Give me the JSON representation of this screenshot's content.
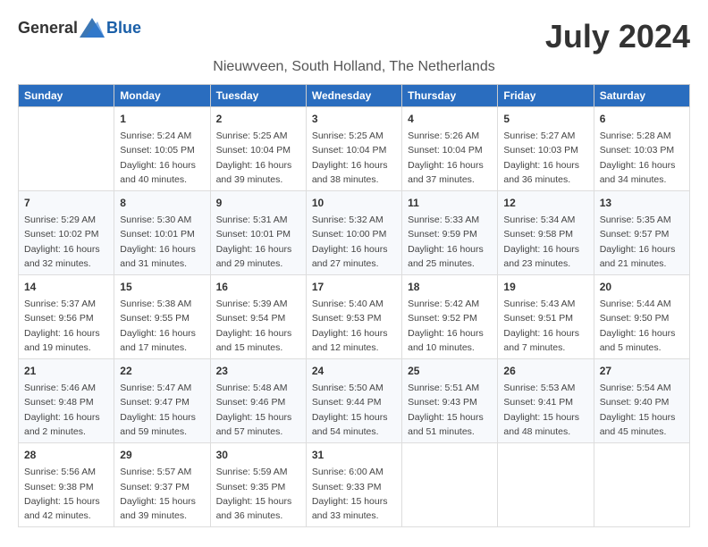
{
  "header": {
    "logo_general": "General",
    "logo_blue": "Blue",
    "month_year": "July 2024",
    "location": "Nieuwveen, South Holland, The Netherlands"
  },
  "columns": [
    "Sunday",
    "Monday",
    "Tuesday",
    "Wednesday",
    "Thursday",
    "Friday",
    "Saturday"
  ],
  "weeks": [
    [
      {
        "day": "",
        "info": ""
      },
      {
        "day": "1",
        "info": "Sunrise: 5:24 AM\nSunset: 10:05 PM\nDaylight: 16 hours\nand 40 minutes."
      },
      {
        "day": "2",
        "info": "Sunrise: 5:25 AM\nSunset: 10:04 PM\nDaylight: 16 hours\nand 39 minutes."
      },
      {
        "day": "3",
        "info": "Sunrise: 5:25 AM\nSunset: 10:04 PM\nDaylight: 16 hours\nand 38 minutes."
      },
      {
        "day": "4",
        "info": "Sunrise: 5:26 AM\nSunset: 10:04 PM\nDaylight: 16 hours\nand 37 minutes."
      },
      {
        "day": "5",
        "info": "Sunrise: 5:27 AM\nSunset: 10:03 PM\nDaylight: 16 hours\nand 36 minutes."
      },
      {
        "day": "6",
        "info": "Sunrise: 5:28 AM\nSunset: 10:03 PM\nDaylight: 16 hours\nand 34 minutes."
      }
    ],
    [
      {
        "day": "7",
        "info": "Sunrise: 5:29 AM\nSunset: 10:02 PM\nDaylight: 16 hours\nand 32 minutes."
      },
      {
        "day": "8",
        "info": "Sunrise: 5:30 AM\nSunset: 10:01 PM\nDaylight: 16 hours\nand 31 minutes."
      },
      {
        "day": "9",
        "info": "Sunrise: 5:31 AM\nSunset: 10:01 PM\nDaylight: 16 hours\nand 29 minutes."
      },
      {
        "day": "10",
        "info": "Sunrise: 5:32 AM\nSunset: 10:00 PM\nDaylight: 16 hours\nand 27 minutes."
      },
      {
        "day": "11",
        "info": "Sunrise: 5:33 AM\nSunset: 9:59 PM\nDaylight: 16 hours\nand 25 minutes."
      },
      {
        "day": "12",
        "info": "Sunrise: 5:34 AM\nSunset: 9:58 PM\nDaylight: 16 hours\nand 23 minutes."
      },
      {
        "day": "13",
        "info": "Sunrise: 5:35 AM\nSunset: 9:57 PM\nDaylight: 16 hours\nand 21 minutes."
      }
    ],
    [
      {
        "day": "14",
        "info": "Sunrise: 5:37 AM\nSunset: 9:56 PM\nDaylight: 16 hours\nand 19 minutes."
      },
      {
        "day": "15",
        "info": "Sunrise: 5:38 AM\nSunset: 9:55 PM\nDaylight: 16 hours\nand 17 minutes."
      },
      {
        "day": "16",
        "info": "Sunrise: 5:39 AM\nSunset: 9:54 PM\nDaylight: 16 hours\nand 15 minutes."
      },
      {
        "day": "17",
        "info": "Sunrise: 5:40 AM\nSunset: 9:53 PM\nDaylight: 16 hours\nand 12 minutes."
      },
      {
        "day": "18",
        "info": "Sunrise: 5:42 AM\nSunset: 9:52 PM\nDaylight: 16 hours\nand 10 minutes."
      },
      {
        "day": "19",
        "info": "Sunrise: 5:43 AM\nSunset: 9:51 PM\nDaylight: 16 hours\nand 7 minutes."
      },
      {
        "day": "20",
        "info": "Sunrise: 5:44 AM\nSunset: 9:50 PM\nDaylight: 16 hours\nand 5 minutes."
      }
    ],
    [
      {
        "day": "21",
        "info": "Sunrise: 5:46 AM\nSunset: 9:48 PM\nDaylight: 16 hours\nand 2 minutes."
      },
      {
        "day": "22",
        "info": "Sunrise: 5:47 AM\nSunset: 9:47 PM\nDaylight: 15 hours\nand 59 minutes."
      },
      {
        "day": "23",
        "info": "Sunrise: 5:48 AM\nSunset: 9:46 PM\nDaylight: 15 hours\nand 57 minutes."
      },
      {
        "day": "24",
        "info": "Sunrise: 5:50 AM\nSunset: 9:44 PM\nDaylight: 15 hours\nand 54 minutes."
      },
      {
        "day": "25",
        "info": "Sunrise: 5:51 AM\nSunset: 9:43 PM\nDaylight: 15 hours\nand 51 minutes."
      },
      {
        "day": "26",
        "info": "Sunrise: 5:53 AM\nSunset: 9:41 PM\nDaylight: 15 hours\nand 48 minutes."
      },
      {
        "day": "27",
        "info": "Sunrise: 5:54 AM\nSunset: 9:40 PM\nDaylight: 15 hours\nand 45 minutes."
      }
    ],
    [
      {
        "day": "28",
        "info": "Sunrise: 5:56 AM\nSunset: 9:38 PM\nDaylight: 15 hours\nand 42 minutes."
      },
      {
        "day": "29",
        "info": "Sunrise: 5:57 AM\nSunset: 9:37 PM\nDaylight: 15 hours\nand 39 minutes."
      },
      {
        "day": "30",
        "info": "Sunrise: 5:59 AM\nSunset: 9:35 PM\nDaylight: 15 hours\nand 36 minutes."
      },
      {
        "day": "31",
        "info": "Sunrise: 6:00 AM\nSunset: 9:33 PM\nDaylight: 15 hours\nand 33 minutes."
      },
      {
        "day": "",
        "info": ""
      },
      {
        "day": "",
        "info": ""
      },
      {
        "day": "",
        "info": ""
      }
    ]
  ]
}
